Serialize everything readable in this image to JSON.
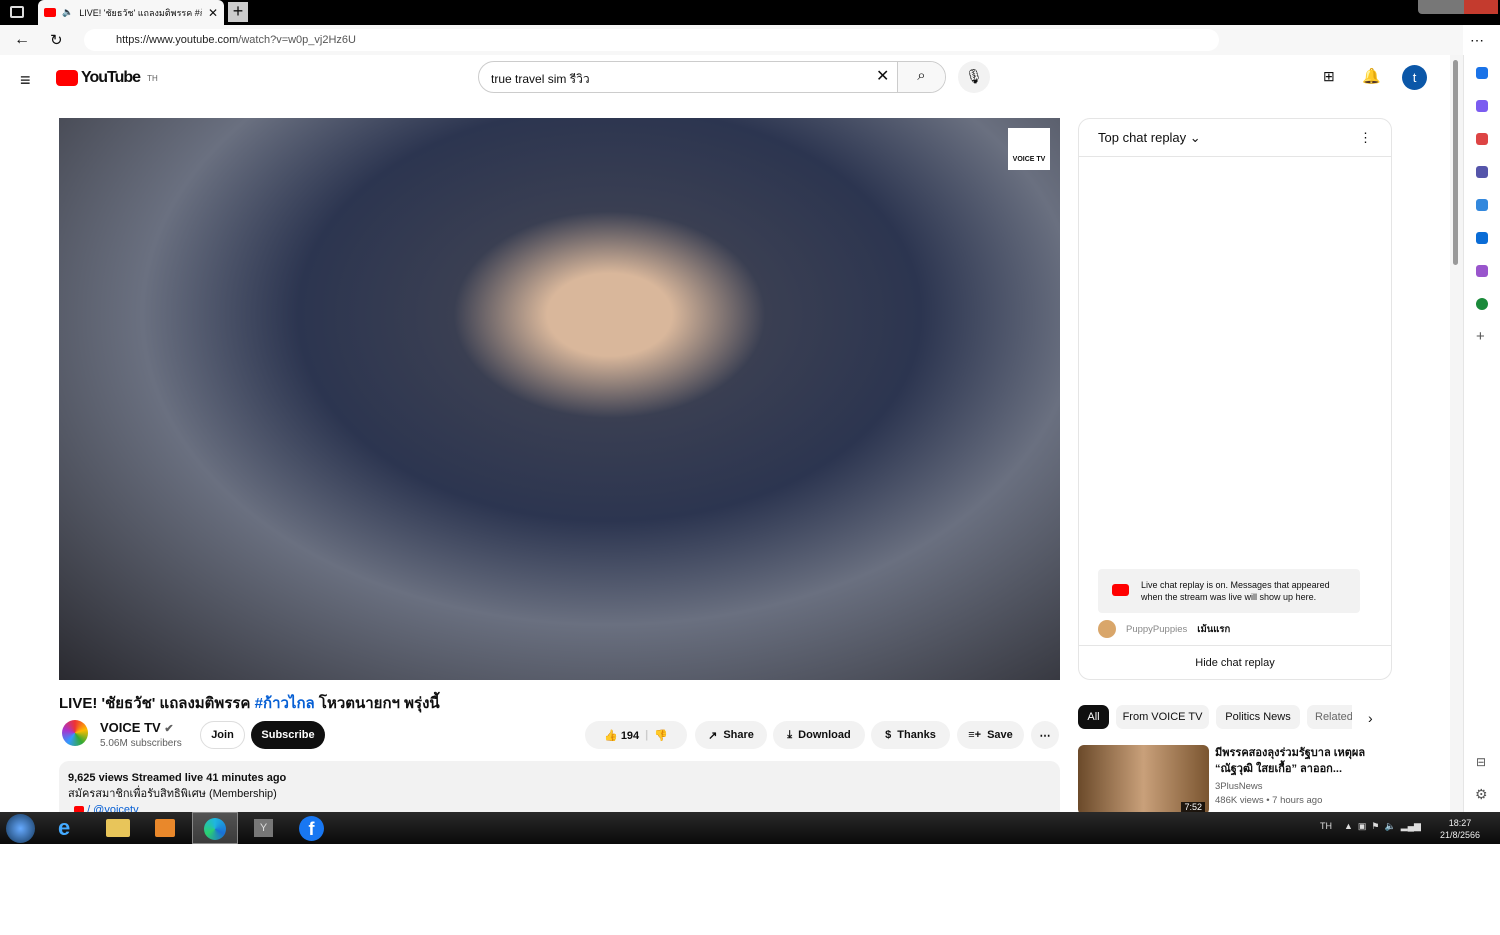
{
  "browser": {
    "tab_title": "LIVE! 'ชัยธวัช' แถลงมติพรรค #ก้าวไกล",
    "url_host": "https://www.youtube.com",
    "url_path": "/watch?v=w0p_vj2Hz6U"
  },
  "youtube": {
    "logo": "YouTube",
    "region": "TH",
    "search_value": "true travel sim รีวิว",
    "avatar_letter": "t"
  },
  "video": {
    "title_prefix": "LIVE! 'ชัยธวัช' แถลงมติพรรค ",
    "hashtag": "#ก้าวไกล",
    "title_suffix": " โหวตนายกฯ พรุ่งนี้",
    "channel_logo": "VOICE TV"
  },
  "channel": {
    "name": "VOICE TV",
    "subscribers": "5.06M subscribers",
    "join": "Join",
    "subscribe": "Subscribe"
  },
  "actions": {
    "likes": "194",
    "share": "Share",
    "download": "Download",
    "thanks": "Thanks",
    "save": "Save"
  },
  "description": {
    "stats": "9,625 views  Streamed live 41 minutes ago",
    "line1": "สมัครสมาชิกเพื่อรับสิทธิพิเศษ (Membership)",
    "link": "/ @voicetv"
  },
  "chat": {
    "header": "Top chat replay",
    "notice": "Live chat replay is on. Messages that appeared when the stream was live will show up here.",
    "messages": [
      {
        "author": "PuppyPuppies",
        "text": "เม้นแรก"
      }
    ],
    "hide": "Hide chat replay"
  },
  "chips": [
    "All",
    "From VOICE TV",
    "Politics News",
    "Related"
  ],
  "related": [
    {
      "title": "มีพรรคสองลุงร่วมรัฐบาล เหตุผล “ณัฐวุฒิ ใสยเกื้อ” ลาออก...",
      "channel": "3PlusNews",
      "meta": "486K views  • 7 hours ago",
      "duration": "7:52"
    }
  ],
  "taskbar": {
    "lang": "TH",
    "time": "18:27",
    "date": "21/8/2566"
  }
}
